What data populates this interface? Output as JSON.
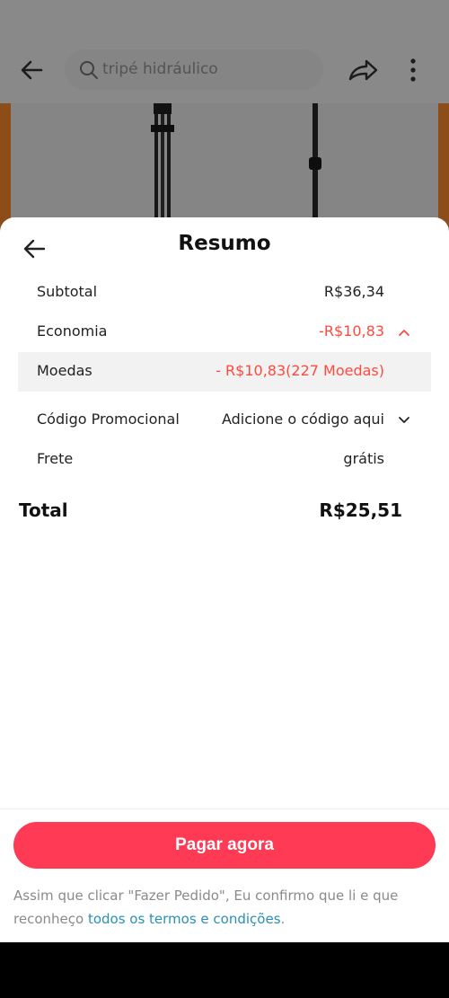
{
  "background": {
    "search_text": "tripé hidráulico"
  },
  "sheet": {
    "title": "Resumo"
  },
  "summary": {
    "subtotal_label": "Subtotal",
    "subtotal_value": "R$36,34",
    "economia_label": "Economia",
    "economia_value": "-R$10,83",
    "moedas_label": "Moedas",
    "moedas_value": "- R$10,83(227 Moedas)",
    "promo_label": "Código Promocional",
    "promo_value": "Adicione o código aqui",
    "frete_label": "Frete",
    "frete_value": "grátis",
    "total_label": "Total",
    "total_value": "R$25,51"
  },
  "footer": {
    "pay_label": "Pagar agora",
    "terms_text": "Assim que clicar \"Fazer Pedido\", Eu confirmo que li e que reconheço ",
    "terms_link": "todos os termos e condições",
    "terms_end": "."
  },
  "colors": {
    "accent": "#ff3a55",
    "discount": "#ff4a3d",
    "link": "#2a8fb8"
  }
}
